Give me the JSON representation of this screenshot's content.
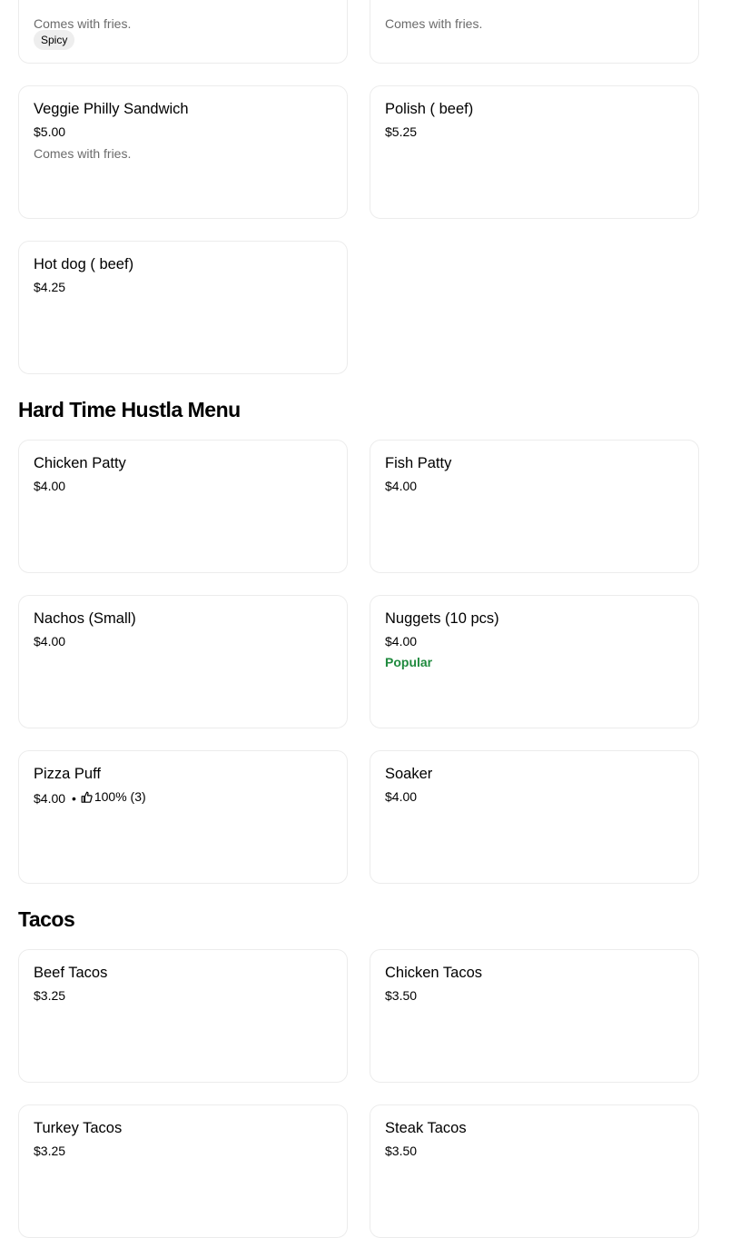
{
  "menu": {
    "top_partial": {
      "left": {
        "description": "Comes with fries.",
        "badge": "Spicy"
      },
      "right": {
        "description": "Comes with fries."
      }
    },
    "sandwich_items": [
      {
        "name": "Veggie Philly Sandwich",
        "price": "$5.00",
        "description": "Comes with fries."
      },
      {
        "name": "Polish ( beef)",
        "price": "$5.25"
      },
      {
        "name": "Hot dog ( beef)",
        "price": "$4.25"
      }
    ],
    "sections": [
      {
        "title": "Hard Time Hustla Menu",
        "items": [
          {
            "name": "Chicken Patty",
            "price": "$4.00"
          },
          {
            "name": "Fish Patty",
            "price": "$4.00"
          },
          {
            "name": "Nachos (Small)",
            "price": "$4.00"
          },
          {
            "name": "Nuggets (10 pcs)",
            "price": "$4.00",
            "tag": "Popular"
          },
          {
            "name": "Pizza Puff",
            "price": "$4.00",
            "separator": "•",
            "rating": "100% (3)"
          },
          {
            "name": "Soaker",
            "price": "$4.00"
          }
        ]
      },
      {
        "title": "Tacos",
        "items": [
          {
            "name": "Beef Tacos",
            "price": "$3.25"
          },
          {
            "name": "Chicken Tacos",
            "price": "$3.50"
          },
          {
            "name": "Turkey Tacos",
            "price": "$3.25"
          },
          {
            "name": "Steak Tacos",
            "price": "$3.50"
          }
        ]
      }
    ]
  },
  "colors": {
    "popular": "#1f8a3e",
    "muted_text": "#6b6b6b",
    "card_border": "#ececec",
    "badge_bg": "#eeeeee"
  },
  "icons": {
    "rating": "thumbs-up-icon"
  }
}
